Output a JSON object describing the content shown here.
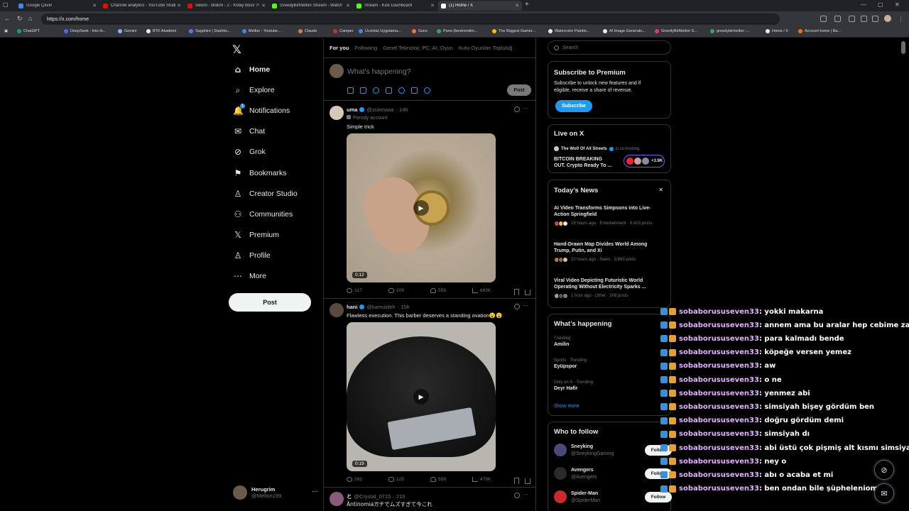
{
  "browser": {
    "tabs": [
      {
        "label": "Google Çeviri",
        "favicon_color": "#4285f4"
      },
      {
        "label": "Channel analytics - YouTube Studi",
        "favicon_color": "#ff0000"
      },
      {
        "label": "Sekiro - Bölüm - 2 - Kolay Boss ?!",
        "favicon_color": "#ff0000"
      },
      {
        "label": "GreedyBirMellon Stream - Watch",
        "favicon_color": "#53fc18"
      },
      {
        "label": "Stream - Kick Dashboard",
        "favicon_color": "#53fc18"
      },
      {
        "label": "(1) Home / X",
        "favicon_color": "#ffffff"
      }
    ],
    "url": "https://x.com/home",
    "bookmarks": [
      {
        "label": "ChatGPT",
        "color": "#10a37f"
      },
      {
        "label": "DeepSeek - Into th...",
        "color": "#4d6bfe"
      },
      {
        "label": "Gemini",
        "color": "#8ab4f8"
      },
      {
        "label": "BTK Akademi",
        "color": "#e8eaed"
      },
      {
        "label": "Sapphire | Dashbo...",
        "color": "#4285f4"
      },
      {
        "label": "Mellon - Youtube...",
        "color": "#4285f4"
      },
      {
        "label": "Claude",
        "color": "#d97757"
      },
      {
        "label": "Camper",
        "color": "#c53030"
      },
      {
        "label": "Ücretsiz Uygulama...",
        "color": "#4285f4"
      },
      {
        "label": "Suno",
        "color": "#ff6b35"
      },
      {
        "label": "Pano (bentrendim...",
        "color": "#34a853"
      },
      {
        "label": "The Biggest Gamer...",
        "color": "#fbbc04"
      },
      {
        "label": "Watercolor Paintin...",
        "color": "#e8eaed"
      },
      {
        "label": "AI Image Generato...",
        "color": "#e8eaed"
      },
      {
        "label": "GreedyBirMellon S...",
        "color": "#e33a7a"
      },
      {
        "label": "greedybirmellon -...",
        "color": "#34a853"
      },
      {
        "label": "Home / X",
        "color": "#e8eaed"
      },
      {
        "label": "Account home | Ba...",
        "color": "#ff6d00"
      }
    ]
  },
  "sidebar": {
    "items": [
      {
        "label": "Home",
        "icon": "home-icon"
      },
      {
        "label": "Explore",
        "icon": "search-icon"
      },
      {
        "label": "Notifications",
        "icon": "bell-icon",
        "badge": "1"
      },
      {
        "label": "Chat",
        "icon": "mail-icon"
      },
      {
        "label": "Grok",
        "icon": "grok-icon"
      },
      {
        "label": "Bookmarks",
        "icon": "bookmark-icon"
      },
      {
        "label": "Creator Studio",
        "icon": "creator-icon"
      },
      {
        "label": "Communities",
        "icon": "communities-icon"
      },
      {
        "label": "Premium",
        "icon": "x-icon"
      },
      {
        "label": "Profile",
        "icon": "profile-icon"
      },
      {
        "label": "More",
        "icon": "more-icon"
      }
    ],
    "post_label": "Post",
    "account": {
      "name": "Herugrim",
      "handle": "@Mellon199"
    }
  },
  "feed": {
    "tabs": [
      "For you",
      "Following",
      "Genel Teknoloji, PC, AI, Oyun",
      "Kutu Oyunları Topluluğ"
    ],
    "composer": {
      "placeholder": "What's happening?",
      "post_label": "Post"
    },
    "tweets": [
      {
        "name": "uma",
        "handle": "@zukmaaa",
        "time": "· 14h",
        "sub": "Parody account",
        "text": "Simple trick",
        "duration": "0:12",
        "replies": "317",
        "reposts": "209",
        "likes": "559",
        "views": "683K"
      },
      {
        "name": "hani",
        "handle": "@kamuideh",
        "time": "· 15h",
        "text": "Flawless execution. This barber deserves a standing ovation😮😮",
        "duration": "0:19",
        "replies": "262",
        "reposts": "125",
        "likes": "559",
        "views": "478K"
      },
      {
        "name": "と",
        "handle": "@Crystal_0715",
        "time": "· 21h",
        "text": "Äntinomiaガチでムズすぎて今これ"
      }
    ]
  },
  "right": {
    "search_placeholder": "Search",
    "premium": {
      "title": "Subscribe to Premium",
      "line1": "Subscribe to unlock new features and if",
      "line2": "eligible, receive a share of revenue.",
      "button": "Subscribe"
    },
    "live": {
      "title": "Live on X",
      "host": "The Wolf Of All Streets",
      "cohost": "is co-hosting",
      "line1": "BITCOIN BREAKING",
      "line2": "OUT. Crypto Ready To ...",
      "count": "+3.9K"
    },
    "news": {
      "title": "Today’s News",
      "close": "✕",
      "items": [
        {
          "line1": "AI Video Transforms Simpsons into Live-",
          "line2": "Action Springfield",
          "meta": "18 hours ago · Entertainment · 6,413 posts"
        },
        {
          "line1": "Hand-Drawn Map Divides World Among",
          "line2": "Trump, Putin, and Xi",
          "meta": "22 hours ago · News · 2,663 posts"
        },
        {
          "line1": "Viral Video Depicting Futuristic World",
          "line2": "Operating Without Electricity Sparks ...",
          "meta": "1 hour ago · Other · 508 posts"
        }
      ]
    },
    "happening": {
      "title": "What’s happening",
      "trends": [
        {
          "meta": "Trending",
          "topic": "Amilin"
        },
        {
          "meta": "Sports · Trending",
          "topic": "Eyüpspor"
        },
        {
          "meta": "Only on X · Trending",
          "topic": "Deyr Hafir"
        }
      ],
      "show_more": "Show more"
    },
    "who_to_follow": {
      "title": "Who to follow",
      "users": [
        {
          "name": "Sneyking",
          "handle": "@SneykingGaming"
        },
        {
          "name": "Avengers",
          "handle": "@Avengers"
        },
        {
          "name": "Spider-Man",
          "handle": "@SpiderMan"
        }
      ],
      "follow_label": "Follow"
    }
  },
  "chat_overlay": [
    {
      "user": "sobaborususeven33",
      "msg": ": yokki makarna"
    },
    {
      "user": "sobaborususeven33",
      "msg": ": annem ama bu aralar hep cebime zarar yaa"
    },
    {
      "user": "sobaborususeven33",
      "msg": ": para kalmadı bende"
    },
    {
      "user": "sobaborususeven33",
      "msg": ": köpeğe versen yemez"
    },
    {
      "user": "sobaborususeven33",
      "msg": ": aw"
    },
    {
      "user": "sobaborususeven33",
      "msg": ": o ne"
    },
    {
      "user": "sobaborususeven33",
      "msg": ": yenmez abi"
    },
    {
      "user": "sobaborususeven33",
      "msg": ": simsiyah bişey gördüm ben"
    },
    {
      "user": "sobaborususeven33",
      "msg": ": doğru gördüm demi"
    },
    {
      "user": "sobaborususeven33",
      "msg": ": simsiyah dı"
    },
    {
      "user": "sobaborususeven33",
      "msg": ": abi üstü çok pişmiş alt kısmı simsiyah"
    },
    {
      "user": "sobaborususeven33",
      "msg": ": ney o"
    },
    {
      "user": "sobaborususeven33",
      "msg": ": abı o acaba et mi"
    },
    {
      "user": "sobaborususeven33",
      "msg": ": ben ondan bile şüpheleniom"
    }
  ],
  "colors": {
    "accent": "#1d9bf0",
    "chat_user": "#e3b2ff",
    "background": "#000000"
  }
}
